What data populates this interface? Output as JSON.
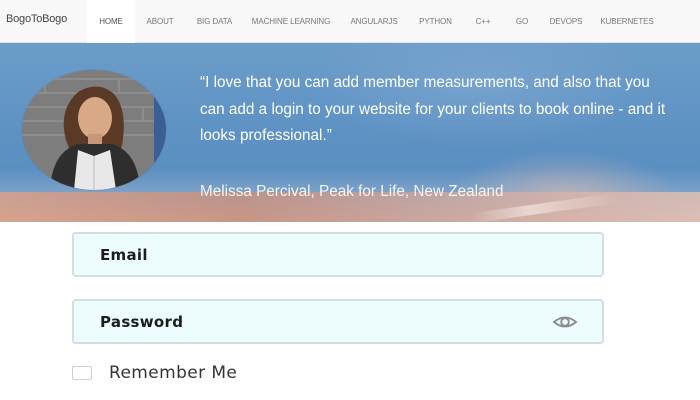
{
  "navbar": {
    "brand": "BogoToBogo",
    "items": [
      {
        "label": "Home",
        "active": true
      },
      {
        "label": "About"
      },
      {
        "label": "Big Data"
      },
      {
        "label": "Machine Learning"
      },
      {
        "label": "AngularJS"
      },
      {
        "label": "Python"
      },
      {
        "label": "C++"
      },
      {
        "label": "go"
      },
      {
        "label": "DevOps"
      },
      {
        "label": "Kubernetes"
      }
    ]
  },
  "hero": {
    "quote": "“I love that you can add member measurements, and also that you can add a login to your website for your clients to book online - and it looks professional.”",
    "attribution": "Melissa Percival, Peak for Life, New Zealand"
  },
  "form": {
    "email_label": "Email",
    "password_label": "Password",
    "remember_label": "Remember Me",
    "remember_checked": false
  },
  "icons": {
    "password_toggle": "eye-icon"
  }
}
